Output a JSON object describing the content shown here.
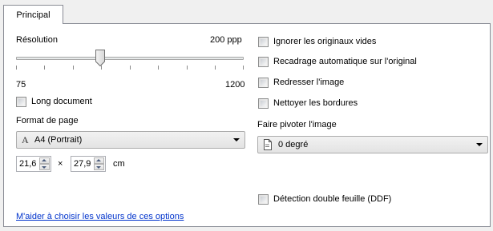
{
  "tabs": [
    {
      "label": "Principal",
      "active": true
    }
  ],
  "resolution": {
    "label": "Résolution",
    "value_text": "200 ppp",
    "min": "75",
    "max": "1200",
    "slider_fraction": 0.4
  },
  "long_document": {
    "label": "Long document",
    "checked": false
  },
  "page_format": {
    "label": "Format de page",
    "icon": "page-format-icon",
    "selected": "A4 (Portrait)",
    "width": "21,6",
    "height": "27,9",
    "times": "×",
    "unit": "cm"
  },
  "options": [
    {
      "label": "Ignorer les originaux vides",
      "checked": false
    },
    {
      "label": "Recadrage automatique sur l'original",
      "checked": false
    },
    {
      "label": "Redresser l'image",
      "checked": false
    },
    {
      "label": "Nettoyer les bordures",
      "checked": false
    }
  ],
  "rotate": {
    "label": "Faire pivoter l'image",
    "icon": "rotate-page-icon",
    "selected": "0 degré"
  },
  "ddf": {
    "label": "Détection double feuille (DDF)",
    "checked": false
  },
  "help_link": "M'aider à choisir les valeurs de ces options",
  "colors": {
    "link": "#0033cc",
    "border": "#898c95"
  }
}
